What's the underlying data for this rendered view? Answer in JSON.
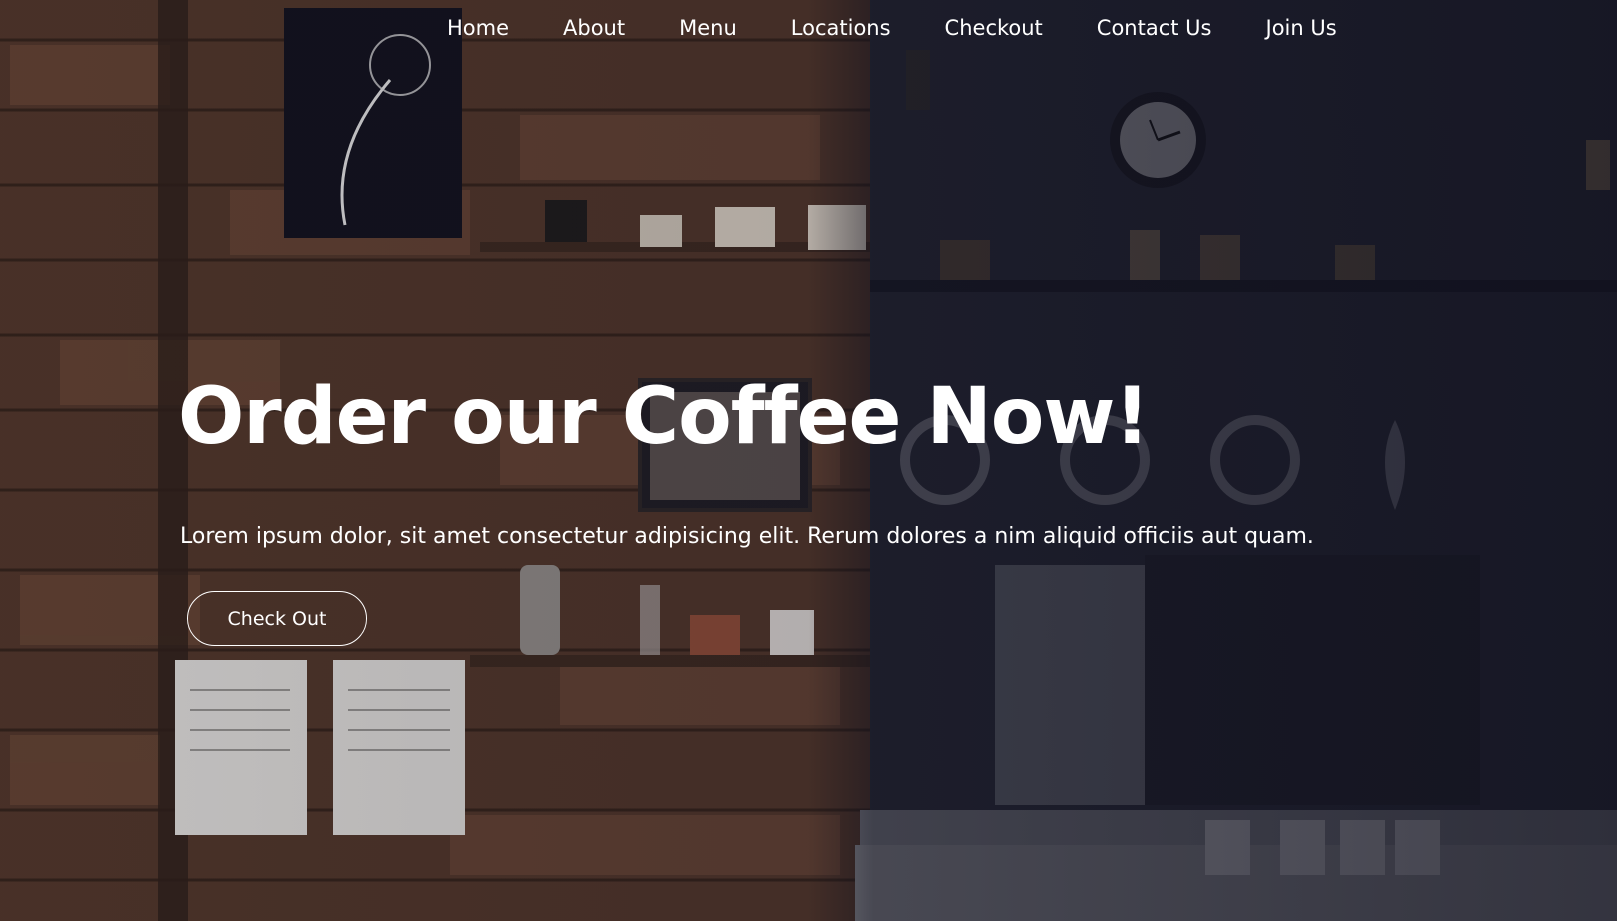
{
  "nav": {
    "items": [
      {
        "label": "Home"
      },
      {
        "label": "About"
      },
      {
        "label": "Menu"
      },
      {
        "label": "Locations"
      },
      {
        "label": "Checkout"
      },
      {
        "label": "Contact Us"
      },
      {
        "label": "Join Us"
      }
    ]
  },
  "hero": {
    "headline": "Order our Coffee Now!",
    "lede": "Lorem ipsum dolor, sit amet consectetur adipisicing elit. Rerum dolores a nim aliquid officiis aut quam.",
    "cta_label": "Check Out"
  },
  "colors": {
    "text": "#ffffff",
    "wood": "#5a3b2c",
    "cafe_dark": "#1c1c2c"
  }
}
